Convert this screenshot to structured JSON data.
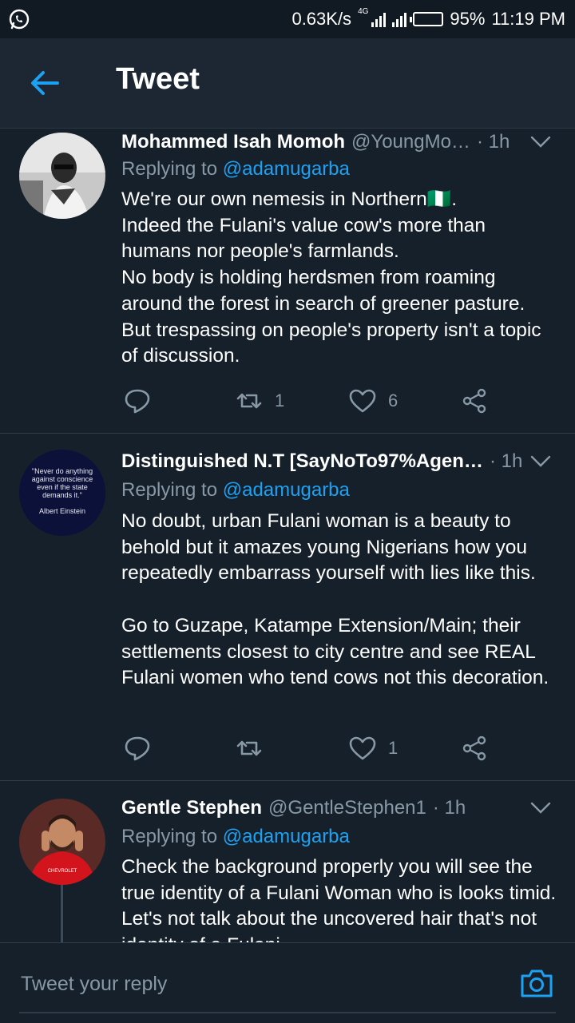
{
  "status_bar": {
    "speed": "0.63K/s",
    "network": "4G",
    "battery_percent": "95%",
    "battery_level": 0.95,
    "time": "11:19 PM"
  },
  "header": {
    "title": "Tweet",
    "back_icon": "arrow-left-icon"
  },
  "colors": {
    "accent": "#1da1f2",
    "background": "#15202b",
    "muted": "#8899a6"
  },
  "tweets": [
    {
      "name": "Mohammed Isah Momoh",
      "handle": "@YoungMo…",
      "time": "· 1h",
      "replying_prefix": "Replying to",
      "replying_to": "@adamugarba",
      "text": "We're our own nemesis in Northern🇳🇬.\nIndeed the Fulani's value cow's more than humans nor people's farmlands.\nNo body is holding herdsmen from roaming around the forest in search of greener pasture.\nBut trespassing on people's property isn't a topic of discussion.",
      "retweets": "1",
      "likes": "6"
    },
    {
      "name": "Distinguished N.T [SayNoTo97%Agen…",
      "handle": "",
      "time": "· 1h",
      "avatar_quote": "\"Never do anything against conscience even if the state demands it.\"",
      "avatar_author": "Albert Einstein",
      "replying_prefix": "Replying to",
      "replying_to": "@adamugarba",
      "text": "No doubt, urban Fulani woman is a beauty to behold but it amazes young Nigerians how you repeatedly embarrass yourself with lies like this.\n\nGo to Guzape, Katampe Extension/Main; their settlements closest to city centre and see REAL Fulani women who tend cows not this decoration.",
      "retweets": "",
      "likes": "1"
    },
    {
      "name": "Gentle Stephen",
      "handle": "@GentleStephen1",
      "time": "· 1h",
      "avatar_badge": "CHEVROLET",
      "replying_prefix": "Replying to",
      "replying_to": "@adamugarba",
      "text": "Check the background properly you will see the true identity of a Fulani Woman who is looks timid. Let's not talk about the uncovered hair that's not identity of a Fulani…"
    }
  ],
  "reply_bar": {
    "placeholder": "Tweet your reply",
    "camera_icon": "camera-icon"
  }
}
